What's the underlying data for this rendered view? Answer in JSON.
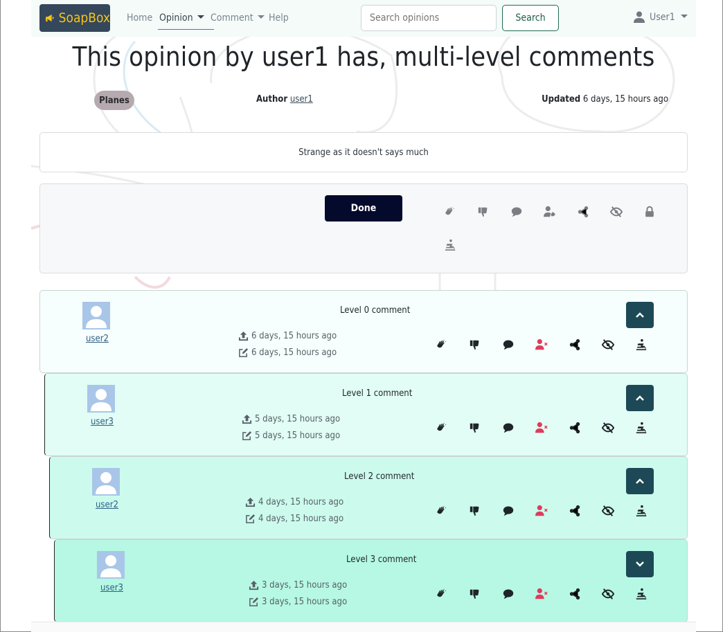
{
  "nav": {
    "brand": "SoapBox",
    "links": [
      {
        "label": "Home"
      },
      {
        "label": "Opinion",
        "dropdown": true,
        "active": true
      },
      {
        "label": "Comment",
        "dropdown": true
      },
      {
        "label": "Help"
      }
    ],
    "search_placeholder": "Search opinions",
    "search_label": "Search",
    "user_label": "User1"
  },
  "opinion": {
    "title": "This opinion by user1 has, multi-level comments",
    "category": "Planes",
    "author_prefix": "Author",
    "author": "user1",
    "updated_prefix": "Updated",
    "updated": "6 days, 15 hours ago",
    "body": "Strange as it doesn't says much",
    "done_label": "Done",
    "action_icons": [
      "clap-icon",
      "thumbs-down-icon",
      "comment-icon",
      "user-follow-icon",
      "share-icon",
      "hide-icon",
      "lock-icon",
      "report-icon"
    ]
  },
  "comments": [
    {
      "user": "user2",
      "text": "Level 0 comment",
      "created": "6 days, 15 hours ago",
      "updated": "6 days, 15 hours ago",
      "expanded": true,
      "bg": "#f6fffd"
    },
    {
      "user": "user3",
      "text": "Level 1 comment",
      "created": "5 days, 15 hours ago",
      "updated": "5 days, 15 hours ago",
      "expanded": true,
      "bg": "#e1fdf5"
    },
    {
      "user": "user2",
      "text": "Level 2 comment",
      "created": "4 days, 15 hours ago",
      "updated": "4 days, 15 hours ago",
      "expanded": true,
      "bg": "#ccfbed"
    },
    {
      "user": "user3",
      "text": "Level 3 comment",
      "created": "3 days, 15 hours ago",
      "updated": "3 days, 15 hours ago",
      "expanded": false,
      "bg": "#b6f8e4"
    }
  ],
  "comment_icons": [
    "clap-icon",
    "thumbs-down-icon",
    "comment-icon",
    "user-block-icon",
    "share-icon",
    "hide-icon",
    "report-icon"
  ],
  "colors": {
    "brand_bg": "#35475a",
    "brand_fg": "#f5c518",
    "toggle_bg": "#1d4957",
    "block_icon": "#e03b5c",
    "done_bg": "#040a2c"
  }
}
